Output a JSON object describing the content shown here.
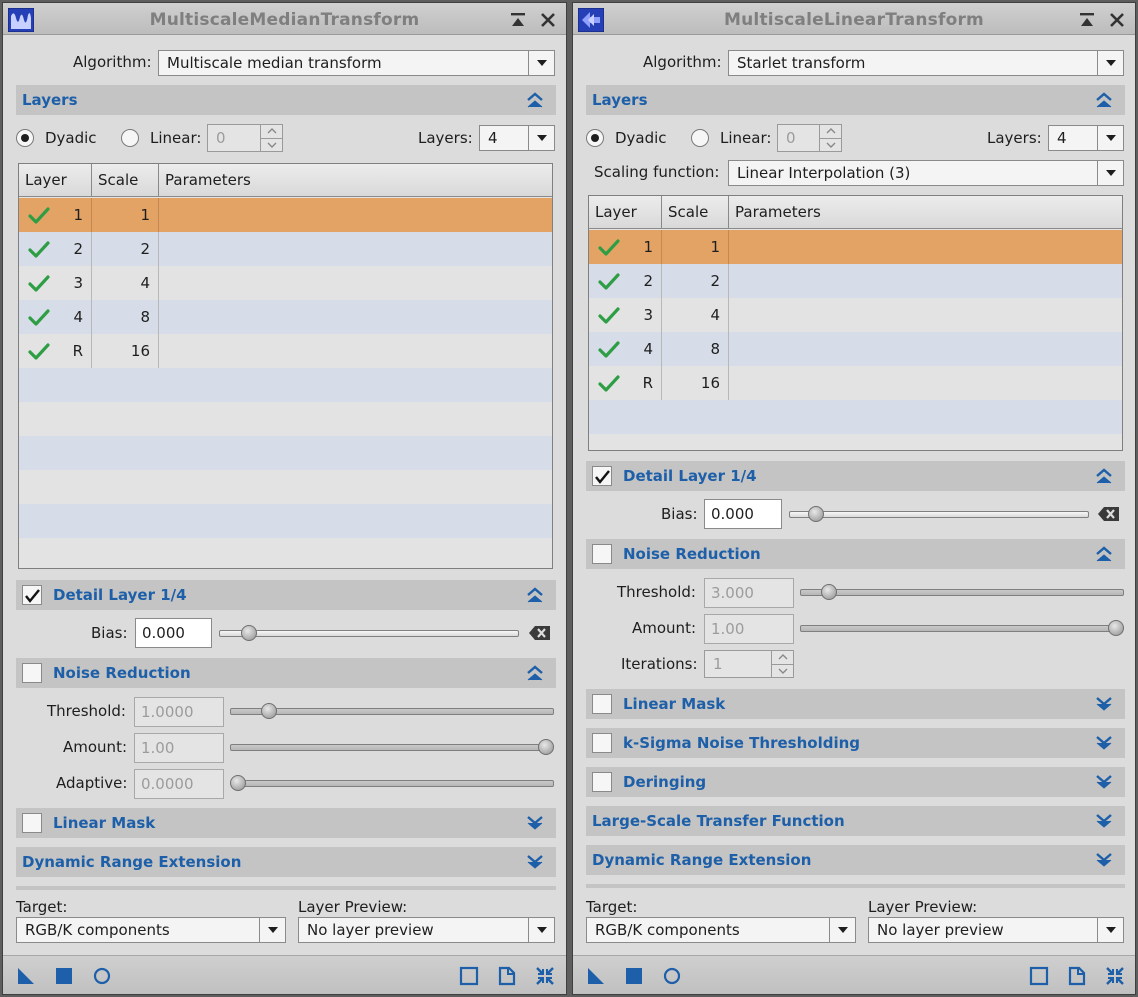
{
  "colors": {
    "accent_blue": "#1d5fa8",
    "selected_row": "#e3a365",
    "alt_row": "#d6dce8",
    "check_green": "#2e9e44"
  },
  "left": {
    "title": "MultiscaleMedianTransform",
    "app_icon": "wave-chart-icon",
    "algorithm_label": "Algorithm:",
    "algorithm_value": "Multiscale median transform",
    "layers_section": "Layers",
    "dyadic_label": "Dyadic",
    "linear_label": "Linear:",
    "linear_value": "0",
    "layers_label": "Layers:",
    "layers_value": "4",
    "table": {
      "headers": [
        "Layer",
        "Scale",
        "Parameters"
      ],
      "rows": [
        {
          "layer": "1",
          "scale": "1",
          "params": ""
        },
        {
          "layer": "2",
          "scale": "2",
          "params": ""
        },
        {
          "layer": "3",
          "scale": "4",
          "params": ""
        },
        {
          "layer": "4",
          "scale": "8",
          "params": ""
        },
        {
          "layer": "R",
          "scale": "16",
          "params": ""
        }
      ]
    },
    "detail_section": "Detail Layer 1/4",
    "bias_label": "Bias:",
    "bias_value": "0.000",
    "bias_slider": 0.1,
    "noise_section": "Noise Reduction",
    "threshold_label": "Threshold:",
    "threshold_value": "1.0000",
    "threshold_slider": 0.12,
    "amount_label": "Amount:",
    "amount_value": "1.00",
    "amount_slider": 1.0,
    "adaptive_label": "Adaptive:",
    "adaptive_value": "0.0000",
    "adaptive_slider": 0.0,
    "linear_mask_section": "Linear Mask",
    "dre_section": "Dynamic Range Extension",
    "target_label": "Target:",
    "target_value": "RGB/K components",
    "preview_label": "Layer Preview:",
    "preview_value": "No layer preview"
  },
  "right": {
    "title": "MultiscaleLinearTransform",
    "app_icon": "wavelet-arrows-icon",
    "algorithm_label": "Algorithm:",
    "algorithm_value": "Starlet transform",
    "layers_section": "Layers",
    "dyadic_label": "Dyadic",
    "linear_label": "Linear:",
    "linear_value": "0",
    "layers_label": "Layers:",
    "layers_value": "4",
    "scaling_label": "Scaling function:",
    "scaling_value": "Linear Interpolation (3)",
    "table": {
      "headers": [
        "Layer",
        "Scale",
        "Parameters"
      ],
      "rows": [
        {
          "layer": "1",
          "scale": "1",
          "params": ""
        },
        {
          "layer": "2",
          "scale": "2",
          "params": ""
        },
        {
          "layer": "3",
          "scale": "4",
          "params": ""
        },
        {
          "layer": "4",
          "scale": "8",
          "params": ""
        },
        {
          "layer": "R",
          "scale": "16",
          "params": ""
        }
      ]
    },
    "detail_section": "Detail Layer 1/4",
    "bias_label": "Bias:",
    "bias_value": "0.000",
    "bias_slider": 0.09,
    "noise_section": "Noise Reduction",
    "threshold_label": "Threshold:",
    "threshold_value": "3.000",
    "threshold_slider": 0.09,
    "amount_label": "Amount:",
    "amount_value": "1.00",
    "amount_slider": 1.0,
    "iterations_label": "Iterations:",
    "iterations_value": "1",
    "linear_mask_section": "Linear Mask",
    "ksigma_section": "k-Sigma Noise Thresholding",
    "deringing_section": "Deringing",
    "lstf_section": "Large-Scale Transfer Function",
    "dre_section": "Dynamic Range Extension",
    "target_label": "Target:",
    "target_value": "RGB/K components",
    "preview_label": "Layer Preview:",
    "preview_value": "No layer preview"
  }
}
